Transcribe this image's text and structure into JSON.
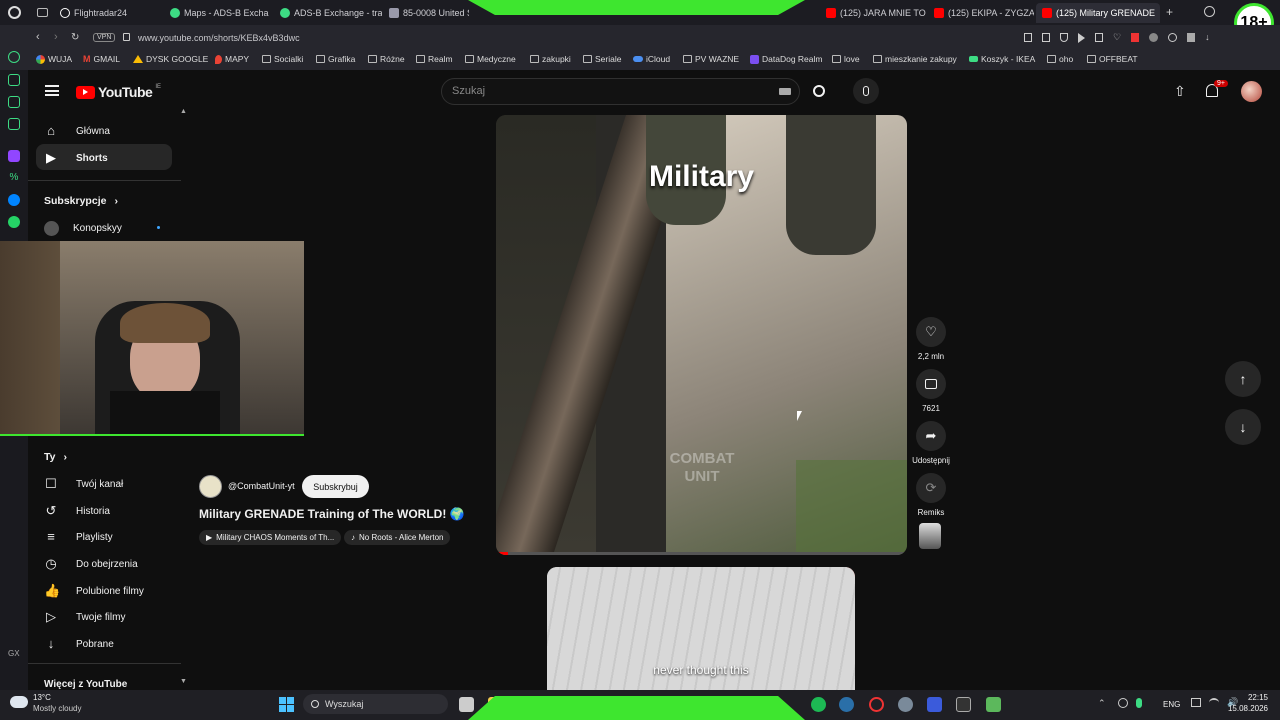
{
  "browser": {
    "tabs": [
      {
        "label": "Flightradar24",
        "color": "#ffffff"
      },
      {
        "label": "Maps - ADS-B Excha",
        "color": "#3ddc84"
      },
      {
        "label": "ADS-B Exchange - tra",
        "color": "#3ddc84"
      },
      {
        "label": "85-0008 United St",
        "color": "#9999aa"
      },
      {
        "label": "(125) JARA MNIE TO I",
        "color": "#ff0000"
      },
      {
        "label": "(125) EKIPA - ZYGZAK",
        "color": "#ff0000"
      },
      {
        "label": "(125) Military GRENADE",
        "color": "#ff0000"
      }
    ],
    "url": "www.youtube.com/shorts/KEBx4vB3dwc",
    "vpn_label": "VPN",
    "bookmarks": [
      "WUJA",
      "GMAIL",
      "DYSK GOOGLE",
      "MAPY",
      "Socialki",
      "Grafika",
      "Różne",
      "Realm",
      "Medyczne",
      "zakupki",
      "Seriale",
      "iCloud",
      "PV WAZNE",
      "DataDog Realm",
      "love",
      "mieszkanie zakupy",
      "Koszyk - IKEA",
      "oho",
      "OFFBEAT"
    ],
    "age_badge": "18+"
  },
  "youtube": {
    "logo_text": "YouTube",
    "logo_sup": "IE",
    "search_placeholder": "Szukaj",
    "notif_count": "9+",
    "sidebar": {
      "main": [
        {
          "label": "Główna",
          "icon": "home-icon"
        },
        {
          "label": "Shorts",
          "icon": "shorts-icon"
        }
      ],
      "subs_heading": "Subskrypcje",
      "subs": [
        {
          "label": "Konopskyy"
        }
      ],
      "you_heading": "Ty",
      "you_items": [
        {
          "label": "Twój kanał"
        },
        {
          "label": "Historia"
        },
        {
          "label": "Playlisty"
        },
        {
          "label": "Do obejrzenia"
        },
        {
          "label": "Polubione filmy"
        },
        {
          "label": "Twoje filmy"
        },
        {
          "label": "Pobrane"
        }
      ],
      "more_heading": "Więcej z YouTube"
    },
    "short": {
      "overlay_title": "Military",
      "watermark": "COMBAT UNIT",
      "channel": "@CombatUnit-yt",
      "subscribe_label": "Subskrybuj",
      "title": "Military GRENADE Training of The WORLD! 🌍",
      "chip_playlist": "Military CHAOS Moments of Th...",
      "chip_music": "No Roots - Alice Merton",
      "likes": "2,2 mln",
      "comments": "7621",
      "share_label": "Udostępnij",
      "remix_label": "Remiks"
    },
    "next_short_caption": "never thought this"
  },
  "taskbar": {
    "weather_temp": "13°C",
    "weather_desc": "Mostly cloudy",
    "search_label": "Wyszukaj",
    "lang": "ENG",
    "time": "22:15",
    "date": "15.08.2026"
  }
}
